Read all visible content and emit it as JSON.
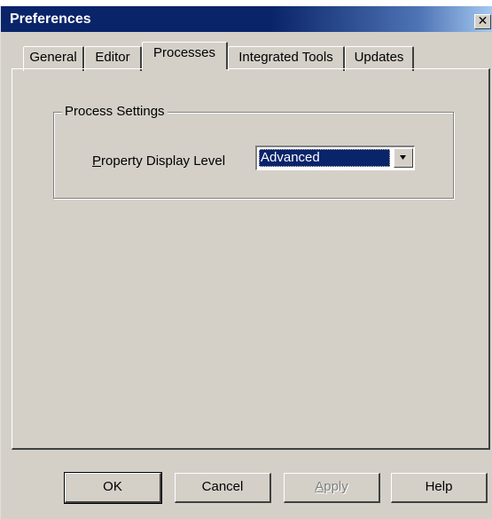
{
  "window": {
    "title": "Preferences",
    "close_symbol": "✕"
  },
  "tabs": [
    {
      "label": "General",
      "active": false
    },
    {
      "label": "Editor",
      "active": false
    },
    {
      "label": "Processes",
      "active": true
    },
    {
      "label": "Integrated Tools",
      "active": false
    },
    {
      "label": "Updates",
      "active": false
    }
  ],
  "process_settings": {
    "group_title": "Process Settings",
    "property_label_accesskey": "P",
    "property_label_rest": "roperty Display Level",
    "display_level_value": "Advanced"
  },
  "buttons": {
    "ok": "OK",
    "cancel": "Cancel",
    "apply_accesskey": "A",
    "apply_rest": "pply",
    "help": "Help"
  },
  "icons": {
    "close": "close-icon",
    "dropdown": "chevron-down-icon"
  },
  "colors": {
    "titlebar": "#0a246a",
    "dialog_face": "#d4d0c8",
    "selection": "#0a246a"
  }
}
